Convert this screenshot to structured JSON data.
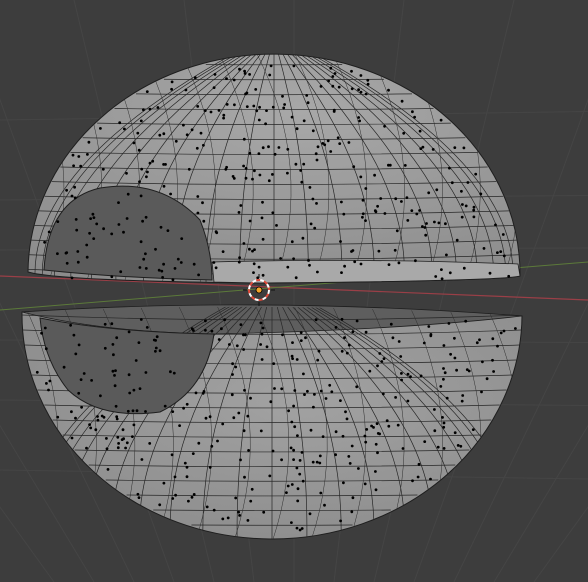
{
  "viewport": {
    "background": "#3d3d3d",
    "grid_color": "#4a4a4a",
    "axis_x_color": "#9a3f47",
    "axis_y_color": "#5c7a3a",
    "mesh_face_color": "#9c9c9c",
    "mesh_face_shadow": "#5c5c5c",
    "wire_color": "#1e1e1e",
    "vertex_color": "#000000"
  },
  "object": {
    "type": "UV sphere split into two hemispheres",
    "selected_vertices_shown": true
  },
  "cursor": {
    "icon": "3d-cursor-icon",
    "ring_color_a": "#e04a3a",
    "ring_color_b": "#ffffff"
  },
  "origin": {
    "icon": "object-origin-icon",
    "color": "#f2a32a"
  }
}
